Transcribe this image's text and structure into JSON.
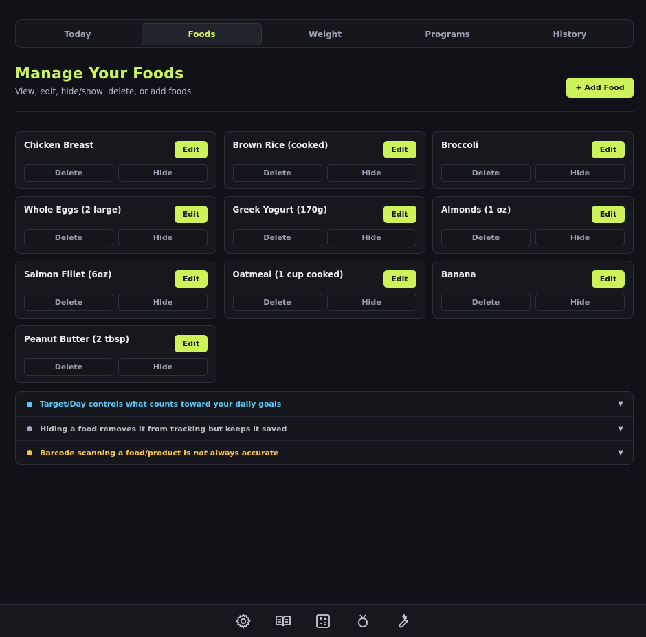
{
  "nav": {
    "tabs": [
      {
        "label": "Today",
        "active": false
      },
      {
        "label": "Foods",
        "active": true
      },
      {
        "label": "Weight",
        "active": false
      },
      {
        "label": "Programs",
        "active": false
      },
      {
        "label": "History",
        "active": false
      }
    ]
  },
  "header": {
    "title": "Manage Your Foods",
    "subtitle": "View, edit, hide/show, delete, or add foods",
    "add_label": "+ Add Food"
  },
  "foods": {
    "edit_label": "Edit",
    "delete_label": "Delete",
    "hide_label": "Hide",
    "items": [
      {
        "name": "Chicken Breast"
      },
      {
        "name": "Brown Rice (cooked)"
      },
      {
        "name": "Broccoli"
      },
      {
        "name": "Whole Eggs (2 large)"
      },
      {
        "name": "Greek Yogurt (170g)"
      },
      {
        "name": "Almonds (1 oz)"
      },
      {
        "name": "Salmon Fillet (6oz)"
      },
      {
        "name": "Oatmeal (1 cup cooked)"
      },
      {
        "name": "Banana"
      },
      {
        "name": "Peanut Butter (2 tbsp)"
      }
    ]
  },
  "info": {
    "items": [
      {
        "text": "Target/Day controls what counts toward your daily goals",
        "color": "#5fc4f0",
        "dot": "#5fc4f0"
      },
      {
        "text": "Hiding a food removes it from tracking but keeps it saved",
        "color": "#b7bac6",
        "dot": "#a3a6b4"
      },
      {
        "text_before": "Barcode scanning a food/product is ",
        "emphasis": "not",
        "text_after": " always accurate",
        "color": "#f5c445",
        "dot": "#f5c445"
      }
    ],
    "chevron": "▼"
  },
  "bottom_bar": {
    "icons": [
      "gear-icon",
      "book-icon",
      "calculator-icon",
      "medal-icon",
      "wrench-icon"
    ]
  },
  "colors": {
    "accent": "#cdf25a",
    "background": "#111217",
    "card": "#16181e"
  }
}
